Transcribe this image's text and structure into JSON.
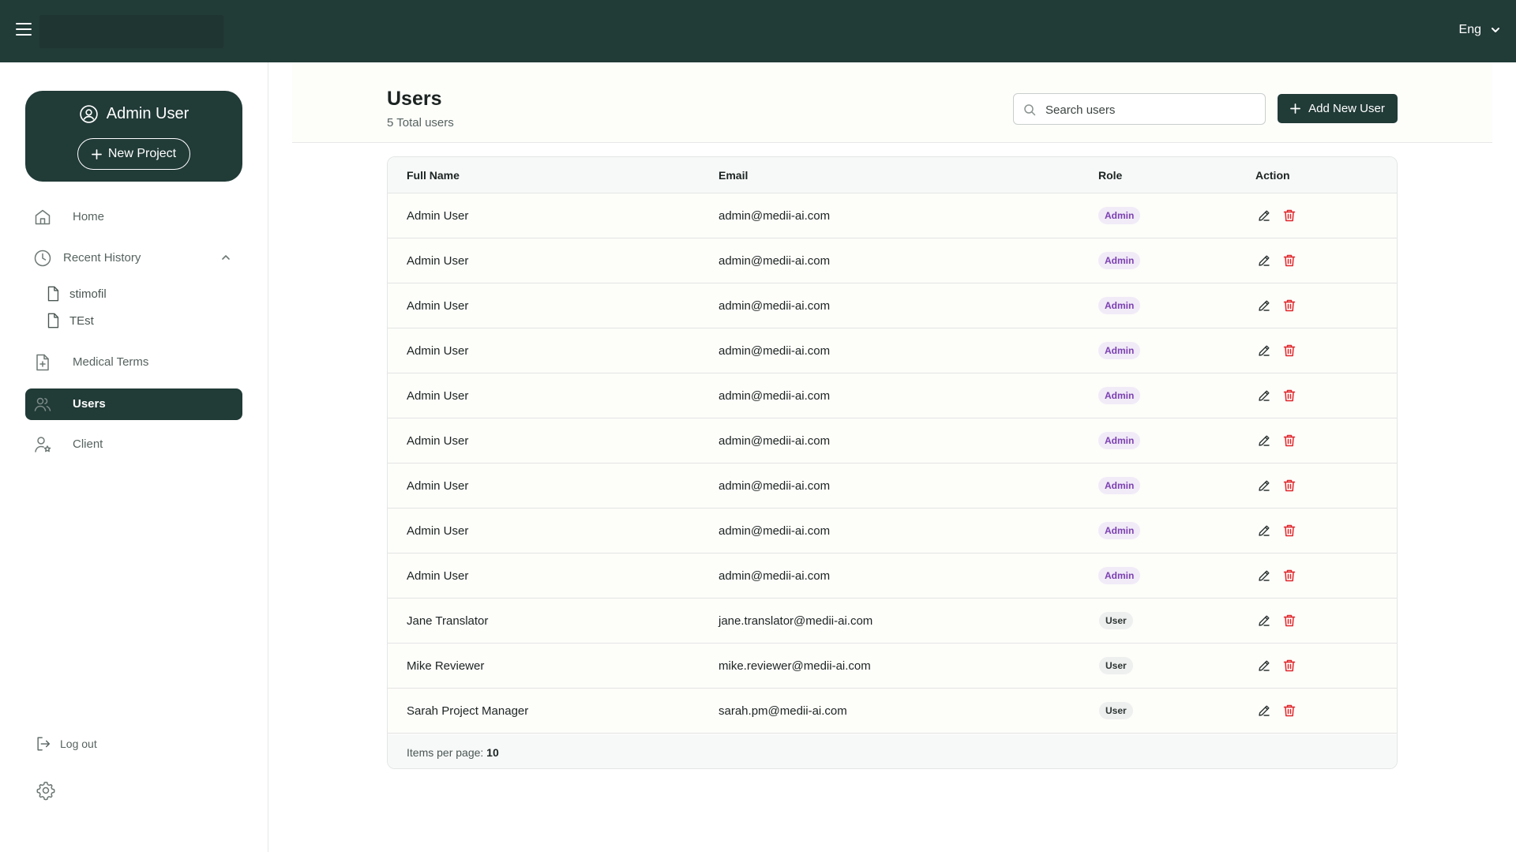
{
  "topbar": {
    "language": "Eng"
  },
  "sidebar": {
    "profile_name": "Admin User",
    "new_project_label": "New Project",
    "nav": {
      "home": "Home",
      "recent_history": "Recent History",
      "medical_terms": "Medical Terms",
      "users": "Users",
      "client": "Client"
    },
    "history": [
      "stimofil",
      "TEst"
    ],
    "logout_label": "Log out"
  },
  "page": {
    "title": "Users",
    "subtitle": "5 Total users",
    "search_placeholder": "Search users",
    "add_user_label": "Add New User"
  },
  "table": {
    "columns": [
      "Full Name",
      "Email",
      "Role",
      "Action"
    ],
    "rows": [
      {
        "name": "Admin User",
        "email": "admin@medii-ai.com",
        "role": "Admin"
      },
      {
        "name": "Admin User",
        "email": "admin@medii-ai.com",
        "role": "Admin"
      },
      {
        "name": "Admin User",
        "email": "admin@medii-ai.com",
        "role": "Admin"
      },
      {
        "name": "Admin User",
        "email": "admin@medii-ai.com",
        "role": "Admin"
      },
      {
        "name": "Admin User",
        "email": "admin@medii-ai.com",
        "role": "Admin"
      },
      {
        "name": "Admin User",
        "email": "admin@medii-ai.com",
        "role": "Admin"
      },
      {
        "name": "Admin User",
        "email": "admin@medii-ai.com",
        "role": "Admin"
      },
      {
        "name": "Admin User",
        "email": "admin@medii-ai.com",
        "role": "Admin"
      },
      {
        "name": "Admin User",
        "email": "admin@medii-ai.com",
        "role": "Admin"
      },
      {
        "name": "Jane Translator",
        "email": "jane.translator@medii-ai.com",
        "role": "User"
      },
      {
        "name": "Mike Reviewer",
        "email": "mike.reviewer@medii-ai.com",
        "role": "User"
      },
      {
        "name": "Sarah Project Manager",
        "email": "sarah.pm@medii-ai.com",
        "role": "User"
      }
    ],
    "items_per_page_label": "Items per page:",
    "items_per_page_value": "10"
  },
  "colors": {
    "brand": "#213b37",
    "admin_badge_bg": "#f1ebf8",
    "admin_badge_text": "#7b3fb0",
    "delete_red": "#e0262b"
  }
}
